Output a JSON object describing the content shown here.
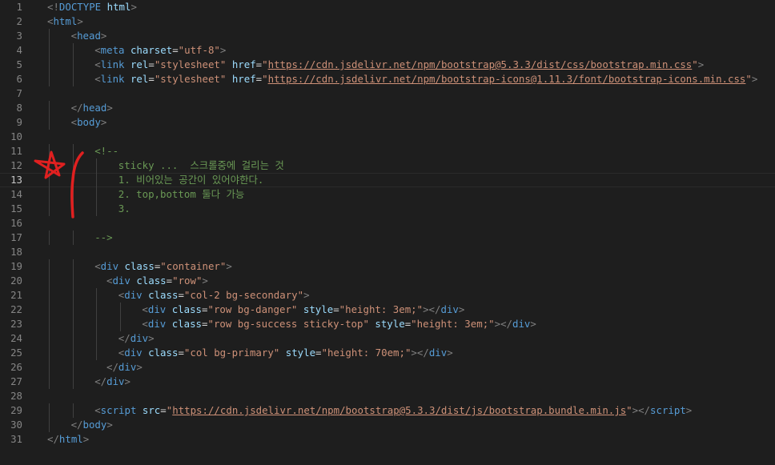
{
  "editor": {
    "line_numbers": [
      "1",
      "2",
      "3",
      "4",
      "5",
      "6",
      "7",
      "8",
      "9",
      "10",
      "11",
      "12",
      "13",
      "14",
      "15",
      "16",
      "17",
      "18",
      "19",
      "20",
      "21",
      "22",
      "23",
      "24",
      "25",
      "26",
      "27",
      "28",
      "29",
      "30",
      "31"
    ],
    "active_line": "13",
    "lines": [
      {
        "indent": 0,
        "tokens": [
          {
            "t": "punc",
            "v": "<!"
          },
          {
            "t": "tag",
            "v": "DOCTYPE"
          },
          {
            "t": "text",
            "v": " "
          },
          {
            "t": "attr",
            "v": "html"
          },
          {
            "t": "punc",
            "v": ">"
          }
        ]
      },
      {
        "indent": 0,
        "tokens": [
          {
            "t": "punc",
            "v": "<"
          },
          {
            "t": "tag",
            "v": "html"
          },
          {
            "t": "punc",
            "v": ">"
          }
        ]
      },
      {
        "indent": 1,
        "tokens": [
          {
            "t": "punc",
            "v": "<"
          },
          {
            "t": "tag",
            "v": "head"
          },
          {
            "t": "punc",
            "v": ">"
          }
        ]
      },
      {
        "indent": 2,
        "tokens": [
          {
            "t": "punc",
            "v": "<"
          },
          {
            "t": "tag",
            "v": "meta"
          },
          {
            "t": "text",
            "v": " "
          },
          {
            "t": "attr",
            "v": "charset"
          },
          {
            "t": "text",
            "v": "="
          },
          {
            "t": "str",
            "v": "\"utf-8\""
          },
          {
            "t": "punc",
            "v": ">"
          }
        ]
      },
      {
        "indent": 2,
        "tokens": [
          {
            "t": "punc",
            "v": "<"
          },
          {
            "t": "tag",
            "v": "link"
          },
          {
            "t": "text",
            "v": " "
          },
          {
            "t": "attr",
            "v": "rel"
          },
          {
            "t": "text",
            "v": "="
          },
          {
            "t": "str",
            "v": "\"stylesheet\""
          },
          {
            "t": "text",
            "v": " "
          },
          {
            "t": "attr",
            "v": "href"
          },
          {
            "t": "text",
            "v": "="
          },
          {
            "t": "str",
            "v": "\""
          },
          {
            "t": "url",
            "v": "https://cdn.jsdelivr.net/npm/bootstrap@5.3.3/dist/css/bootstrap.min.css"
          },
          {
            "t": "str",
            "v": "\""
          },
          {
            "t": "punc",
            "v": ">"
          }
        ]
      },
      {
        "indent": 2,
        "tokens": [
          {
            "t": "punc",
            "v": "<"
          },
          {
            "t": "tag",
            "v": "link"
          },
          {
            "t": "text",
            "v": " "
          },
          {
            "t": "attr",
            "v": "rel"
          },
          {
            "t": "text",
            "v": "="
          },
          {
            "t": "str",
            "v": "\"stylesheet\""
          },
          {
            "t": "text",
            "v": " "
          },
          {
            "t": "attr",
            "v": "href"
          },
          {
            "t": "text",
            "v": "="
          },
          {
            "t": "str",
            "v": "\""
          },
          {
            "t": "url",
            "v": "https://cdn.jsdelivr.net/npm/bootstrap-icons@1.11.3/font/bootstrap-icons.min.css"
          },
          {
            "t": "str",
            "v": "\""
          },
          {
            "t": "punc",
            "v": ">"
          }
        ]
      },
      {
        "indent": 0,
        "tokens": []
      },
      {
        "indent": 1,
        "tokens": [
          {
            "t": "punc",
            "v": "</"
          },
          {
            "t": "tag",
            "v": "head"
          },
          {
            "t": "punc",
            "v": ">"
          }
        ]
      },
      {
        "indent": 1,
        "tokens": [
          {
            "t": "punc",
            "v": "<"
          },
          {
            "t": "tag",
            "v": "body"
          },
          {
            "t": "punc",
            "v": ">"
          }
        ]
      },
      {
        "indent": 0,
        "tokens": []
      },
      {
        "indent": 2,
        "tokens": [
          {
            "t": "cmt",
            "v": "<!--"
          }
        ]
      },
      {
        "indent": 3,
        "tokens": [
          {
            "t": "cmt",
            "v": "sticky ...  스크롤중에 걸리는 것"
          }
        ]
      },
      {
        "indent": 3,
        "tokens": [
          {
            "t": "cmt",
            "v": "1. 비어있는 공간이 있어야한다."
          }
        ]
      },
      {
        "indent": 3,
        "tokens": [
          {
            "t": "cmt",
            "v": "2. top,bottom 둘다 가능"
          }
        ]
      },
      {
        "indent": 3,
        "tokens": [
          {
            "t": "cmt",
            "v": "3."
          }
        ]
      },
      {
        "indent": 0,
        "tokens": []
      },
      {
        "indent": 2,
        "tokens": [
          {
            "t": "cmt",
            "v": "-->"
          }
        ]
      },
      {
        "indent": 0,
        "tokens": []
      },
      {
        "indent": 2,
        "tokens": [
          {
            "t": "punc",
            "v": "<"
          },
          {
            "t": "tag",
            "v": "div"
          },
          {
            "t": "text",
            "v": " "
          },
          {
            "t": "attr",
            "v": "class"
          },
          {
            "t": "text",
            "v": "="
          },
          {
            "t": "str",
            "v": "\"container\""
          },
          {
            "t": "punc",
            "v": ">"
          }
        ]
      },
      {
        "indent": 2.5,
        "tokens": [
          {
            "t": "punc",
            "v": "<"
          },
          {
            "t": "tag",
            "v": "div"
          },
          {
            "t": "text",
            "v": " "
          },
          {
            "t": "attr",
            "v": "class"
          },
          {
            "t": "text",
            "v": "="
          },
          {
            "t": "str",
            "v": "\"row\""
          },
          {
            "t": "punc",
            "v": ">"
          }
        ]
      },
      {
        "indent": 3,
        "tokens": [
          {
            "t": "punc",
            "v": "<"
          },
          {
            "t": "tag",
            "v": "div"
          },
          {
            "t": "text",
            "v": " "
          },
          {
            "t": "attr",
            "v": "class"
          },
          {
            "t": "text",
            "v": "="
          },
          {
            "t": "str",
            "v": "\"col-2 bg-secondary\""
          },
          {
            "t": "punc",
            "v": ">"
          }
        ]
      },
      {
        "indent": 4,
        "tokens": [
          {
            "t": "punc",
            "v": "<"
          },
          {
            "t": "tag",
            "v": "div"
          },
          {
            "t": "text",
            "v": " "
          },
          {
            "t": "attr",
            "v": "class"
          },
          {
            "t": "text",
            "v": "="
          },
          {
            "t": "str",
            "v": "\"row bg-danger\""
          },
          {
            "t": "text",
            "v": " "
          },
          {
            "t": "attr",
            "v": "style"
          },
          {
            "t": "text",
            "v": "="
          },
          {
            "t": "str",
            "v": "\"height: 3em;\""
          },
          {
            "t": "punc",
            "v": "></"
          },
          {
            "t": "tag",
            "v": "div"
          },
          {
            "t": "punc",
            "v": ">"
          }
        ]
      },
      {
        "indent": 4,
        "tokens": [
          {
            "t": "punc",
            "v": "<"
          },
          {
            "t": "tag",
            "v": "div"
          },
          {
            "t": "text",
            "v": " "
          },
          {
            "t": "attr",
            "v": "class"
          },
          {
            "t": "text",
            "v": "="
          },
          {
            "t": "str",
            "v": "\"row bg-success sticky-top\""
          },
          {
            "t": "text",
            "v": " "
          },
          {
            "t": "attr",
            "v": "style"
          },
          {
            "t": "text",
            "v": "="
          },
          {
            "t": "str",
            "v": "\"height: 3em;\""
          },
          {
            "t": "punc",
            "v": "></"
          },
          {
            "t": "tag",
            "v": "div"
          },
          {
            "t": "punc",
            "v": ">"
          }
        ]
      },
      {
        "indent": 3,
        "tokens": [
          {
            "t": "punc",
            "v": "</"
          },
          {
            "t": "tag",
            "v": "div"
          },
          {
            "t": "punc",
            "v": ">"
          }
        ]
      },
      {
        "indent": 3,
        "tokens": [
          {
            "t": "punc",
            "v": "<"
          },
          {
            "t": "tag",
            "v": "div"
          },
          {
            "t": "text",
            "v": " "
          },
          {
            "t": "attr",
            "v": "class"
          },
          {
            "t": "text",
            "v": "="
          },
          {
            "t": "str",
            "v": "\"col bg-primary\""
          },
          {
            "t": "text",
            "v": " "
          },
          {
            "t": "attr",
            "v": "style"
          },
          {
            "t": "text",
            "v": "="
          },
          {
            "t": "str",
            "v": "\"height: 70em;\""
          },
          {
            "t": "punc",
            "v": "></"
          },
          {
            "t": "tag",
            "v": "div"
          },
          {
            "t": "punc",
            "v": ">"
          }
        ]
      },
      {
        "indent": 2.5,
        "tokens": [
          {
            "t": "punc",
            "v": "</"
          },
          {
            "t": "tag",
            "v": "div"
          },
          {
            "t": "punc",
            "v": ">"
          }
        ]
      },
      {
        "indent": 2,
        "tokens": [
          {
            "t": "punc",
            "v": "</"
          },
          {
            "t": "tag",
            "v": "div"
          },
          {
            "t": "punc",
            "v": ">"
          }
        ]
      },
      {
        "indent": 0,
        "tokens": []
      },
      {
        "indent": 2,
        "tokens": [
          {
            "t": "punc",
            "v": "<"
          },
          {
            "t": "tag",
            "v": "script"
          },
          {
            "t": "text",
            "v": " "
          },
          {
            "t": "attr",
            "v": "src"
          },
          {
            "t": "text",
            "v": "="
          },
          {
            "t": "str",
            "v": "\""
          },
          {
            "t": "url",
            "v": "https://cdn.jsdelivr.net/npm/bootstrap@5.3.3/dist/js/bootstrap.bundle.min.js"
          },
          {
            "t": "str",
            "v": "\""
          },
          {
            "t": "punc",
            "v": "></"
          },
          {
            "t": "tag",
            "v": "script"
          },
          {
            "t": "punc",
            "v": ">"
          }
        ]
      },
      {
        "indent": 1,
        "tokens": [
          {
            "t": "punc",
            "v": "</"
          },
          {
            "t": "tag",
            "v": "body"
          },
          {
            "t": "punc",
            "v": ">"
          }
        ]
      },
      {
        "indent": 0,
        "tokens": [
          {
            "t": "punc",
            "v": "</"
          },
          {
            "t": "tag",
            "v": "html"
          },
          {
            "t": "punc",
            "v": ">"
          }
        ]
      }
    ]
  },
  "annotation": {
    "shape": "star-and-bracket-scribble",
    "color": "#e02020"
  },
  "colors": {
    "background": "#1e1e1e",
    "line_number": "#858585",
    "tag": "#569cd6",
    "attribute": "#9cdcfe",
    "string": "#ce9178",
    "comment": "#6a9955",
    "punctuation": "#808080"
  }
}
